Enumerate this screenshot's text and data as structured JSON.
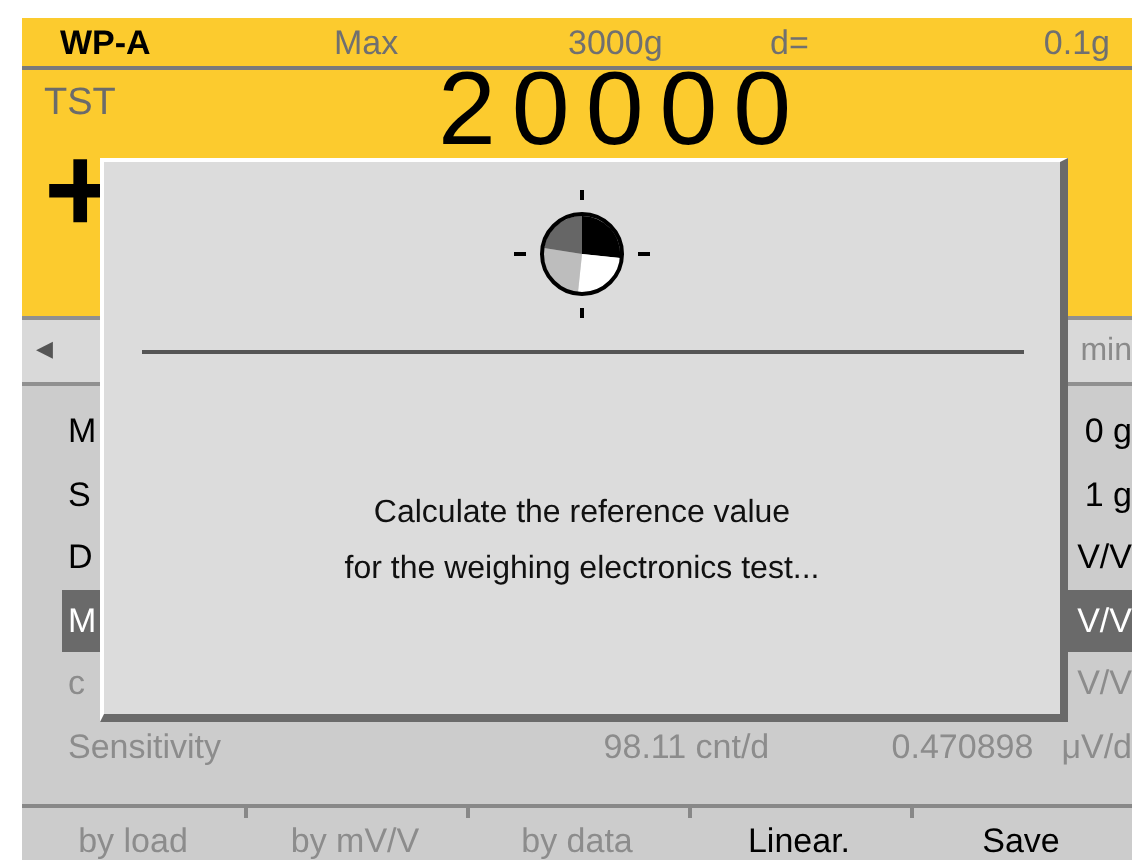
{
  "header": {
    "model": "WP-A",
    "max_label": "Max",
    "max_value": "3000g",
    "d_label": "d=",
    "d_value": "0.1g"
  },
  "display": {
    "mode": "TST",
    "sign": "+",
    "value": "20000"
  },
  "list_header": {
    "arrow": "◀",
    "column": "min"
  },
  "rows": [
    {
      "label": "M",
      "value": "0 g",
      "selected": false,
      "disabled": false
    },
    {
      "label": "S",
      "value": "1 g",
      "selected": false,
      "disabled": false
    },
    {
      "label": "D",
      "value": "V/V",
      "selected": false,
      "disabled": false
    },
    {
      "label": "M",
      "value": "V/V",
      "selected": true,
      "disabled": false
    },
    {
      "label": "c",
      "value": "V/V",
      "selected": false,
      "disabled": true
    },
    {
      "label": "Sensitivity",
      "value": "98.11 cnt/d",
      "value_2": "0.470898",
      "unit": "μV/d",
      "selected": false,
      "disabled": true
    }
  ],
  "softkeys": [
    {
      "label": "by load",
      "disabled": true
    },
    {
      "label": "by mV/V",
      "disabled": true
    },
    {
      "label": "by data",
      "disabled": true
    },
    {
      "label": "Linear.",
      "disabled": false
    },
    {
      "label": "Save",
      "disabled": false
    }
  ],
  "dialog": {
    "message": [
      "Calculate the reference value",
      "for the weighing electronics test..."
    ]
  }
}
